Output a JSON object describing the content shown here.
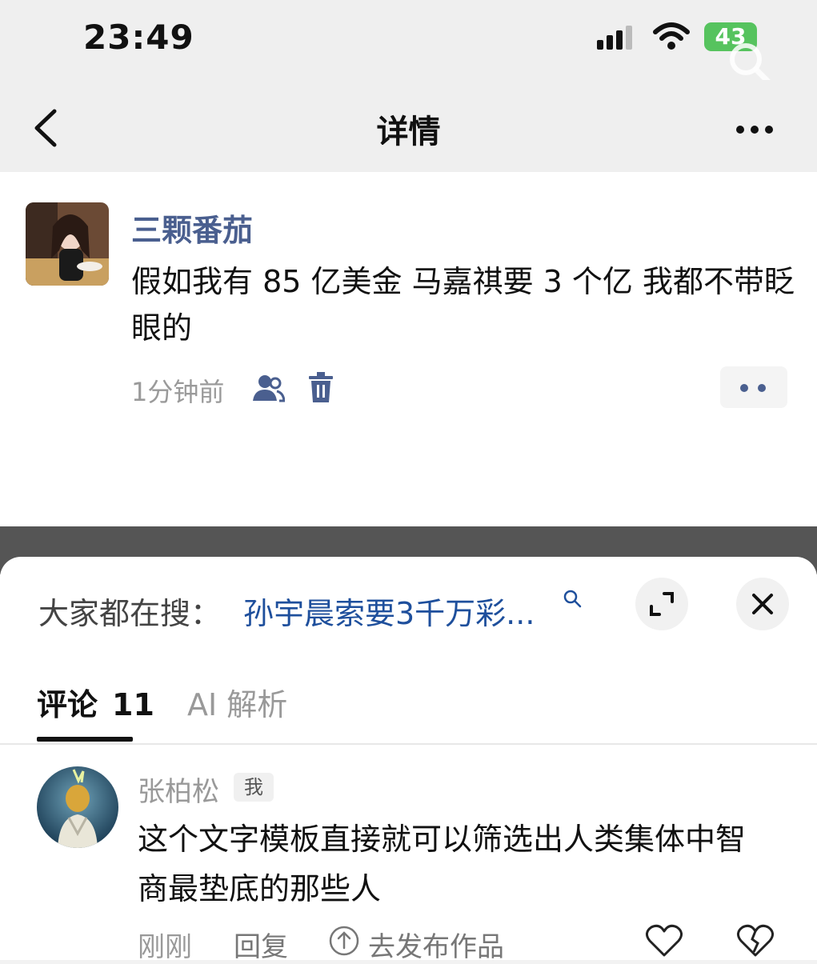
{
  "status_bar": {
    "time": "23:49",
    "battery": "43"
  },
  "nav": {
    "title": "详情"
  },
  "post": {
    "author": "三颗番茄",
    "text": "假如我有 85 亿美金 马嘉祺要 3 个亿 我都不带眨眼的",
    "time_ago": "1分钟前"
  },
  "sheet": {
    "trending_label": "大家都在搜：",
    "trending_query": "孙宇晨索要3千万彩..."
  },
  "tabs": [
    {
      "label": "评论",
      "count": "11",
      "active": true
    },
    {
      "label": "AI 解析",
      "active": false
    }
  ],
  "comment": {
    "author": "张柏松",
    "badge": "我",
    "text": "这个文字模板直接就可以筛选出人类集体中智商最垫底的那些人",
    "time": "刚刚",
    "reply_label": "回复",
    "publish_label": "去发布作品"
  },
  "colors": {
    "link_blue": "#1e4f9c",
    "author_blue": "#4a5f8f",
    "battery_green": "#56c35e"
  },
  "icons": [
    "back-icon",
    "more-icon",
    "search-icon",
    "people-icon",
    "trash-icon",
    "expand-icon",
    "close-icon",
    "up-arrow-circle-icon",
    "heart-icon",
    "broken-heart-icon"
  ]
}
